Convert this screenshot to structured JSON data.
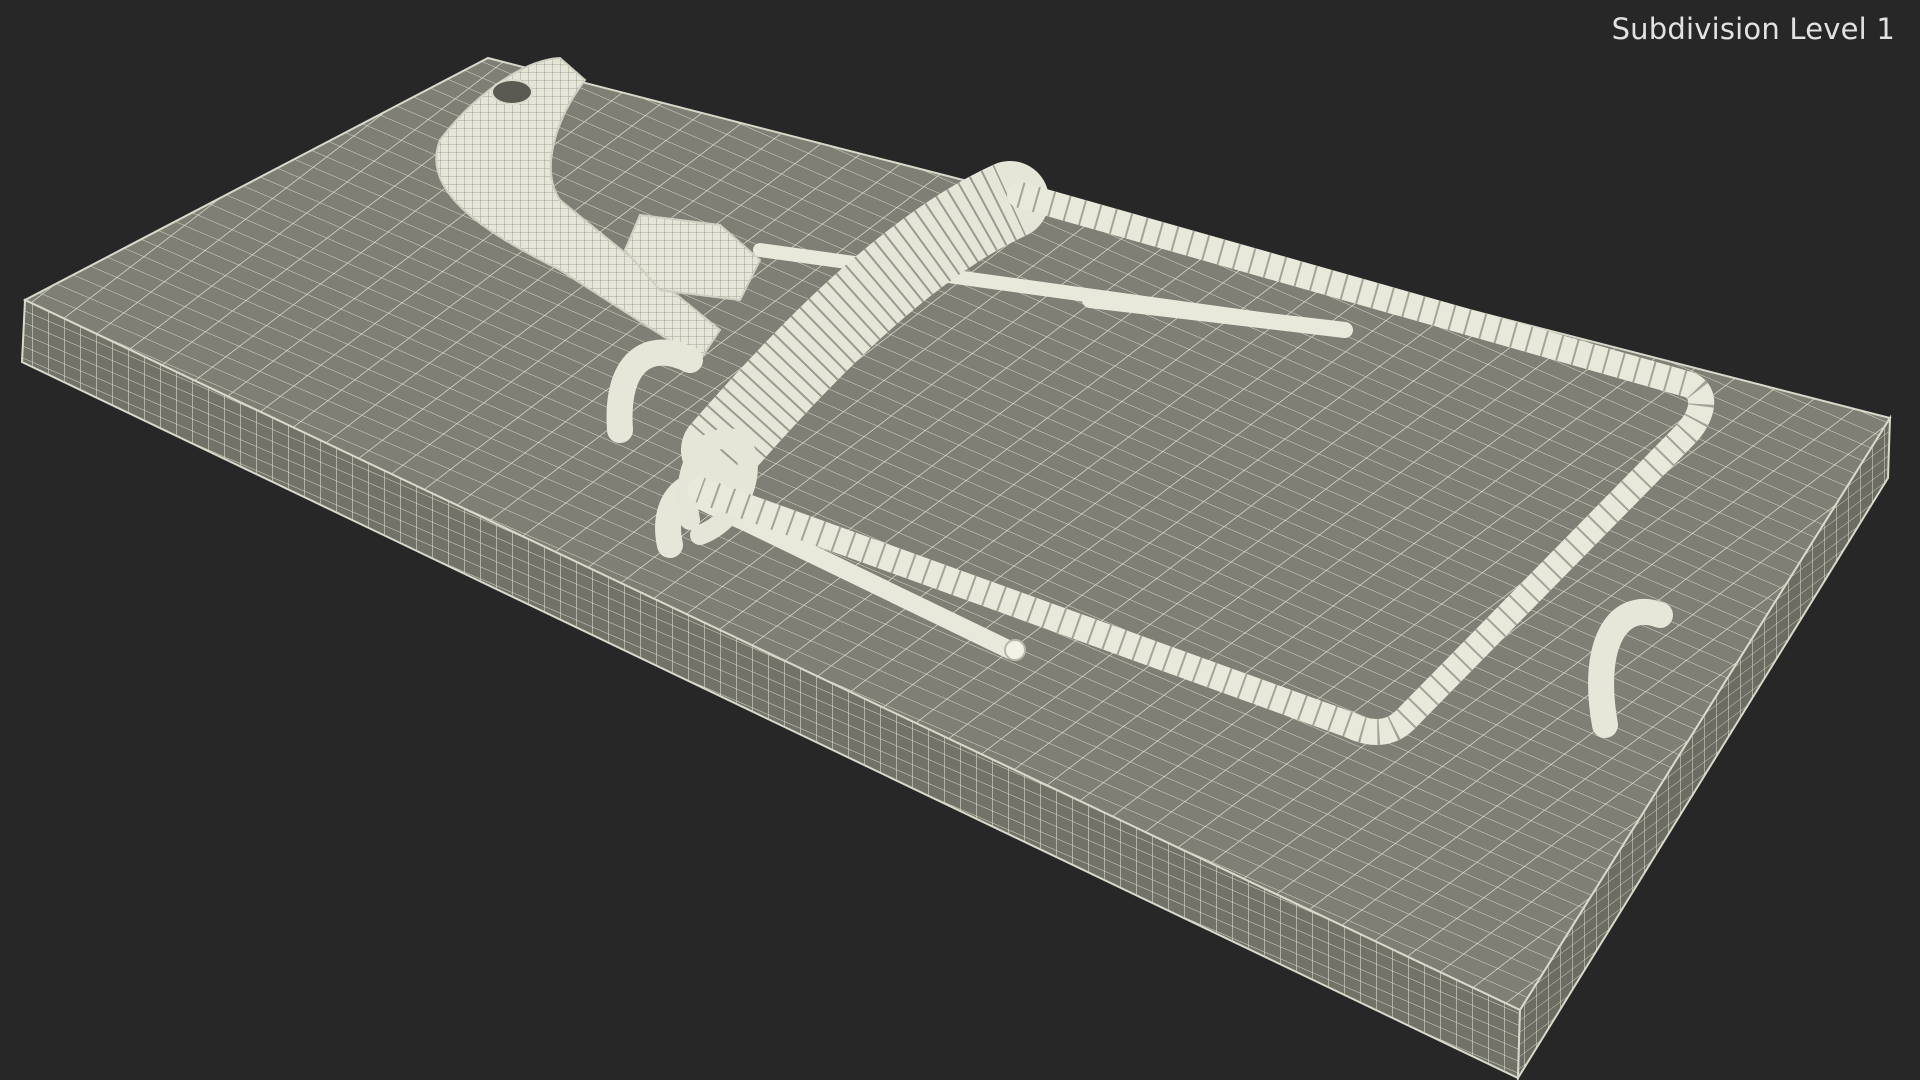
{
  "viewport": {
    "label": "Subdivision Level 1",
    "background": "#272727"
  },
  "model": {
    "base_color": "#7e7e74",
    "wire_color": "#eeeee2",
    "icon": "mousetrap-wireframe"
  }
}
